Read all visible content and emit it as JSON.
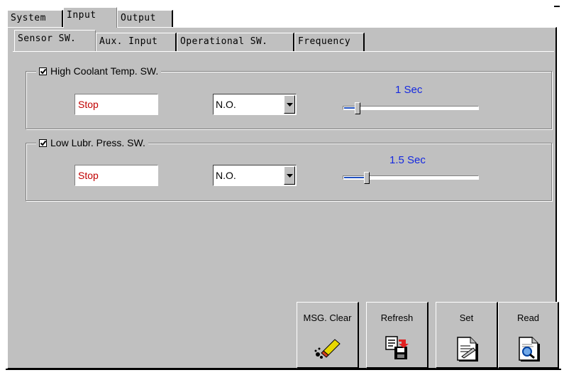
{
  "top_tabs": [
    {
      "label": "System"
    },
    {
      "label": "Input"
    },
    {
      "label": "Output"
    }
  ],
  "sub_tabs": [
    {
      "label": "Sensor SW."
    },
    {
      "label": "Aux. Input"
    },
    {
      "label": "Operational SW."
    },
    {
      "label": "Frequency"
    }
  ],
  "groups": [
    {
      "title": "High Coolant Temp. SW.",
      "checked": true,
      "action_value": "Stop",
      "contact_value": "N.O.",
      "delay_label": "1 Sec",
      "slider_fraction": 0.05
    },
    {
      "title": "Low Lubr. Press. SW.",
      "checked": true,
      "action_value": "Stop",
      "contact_value": "N.O.",
      "delay_label": "1.5 Sec",
      "slider_fraction": 0.12
    }
  ],
  "buttons": [
    {
      "label": "MSG. Clear",
      "icon": "eraser-icon"
    },
    {
      "label": "Refresh",
      "icon": "refresh-disk-icon"
    },
    {
      "label": "Set",
      "icon": "document-pen-icon"
    },
    {
      "label": "Read",
      "icon": "document-magnifier-icon"
    }
  ],
  "colors": {
    "panel": "#c0c0c0",
    "value_text": "#c00000",
    "slider_label": "#1428e0"
  }
}
